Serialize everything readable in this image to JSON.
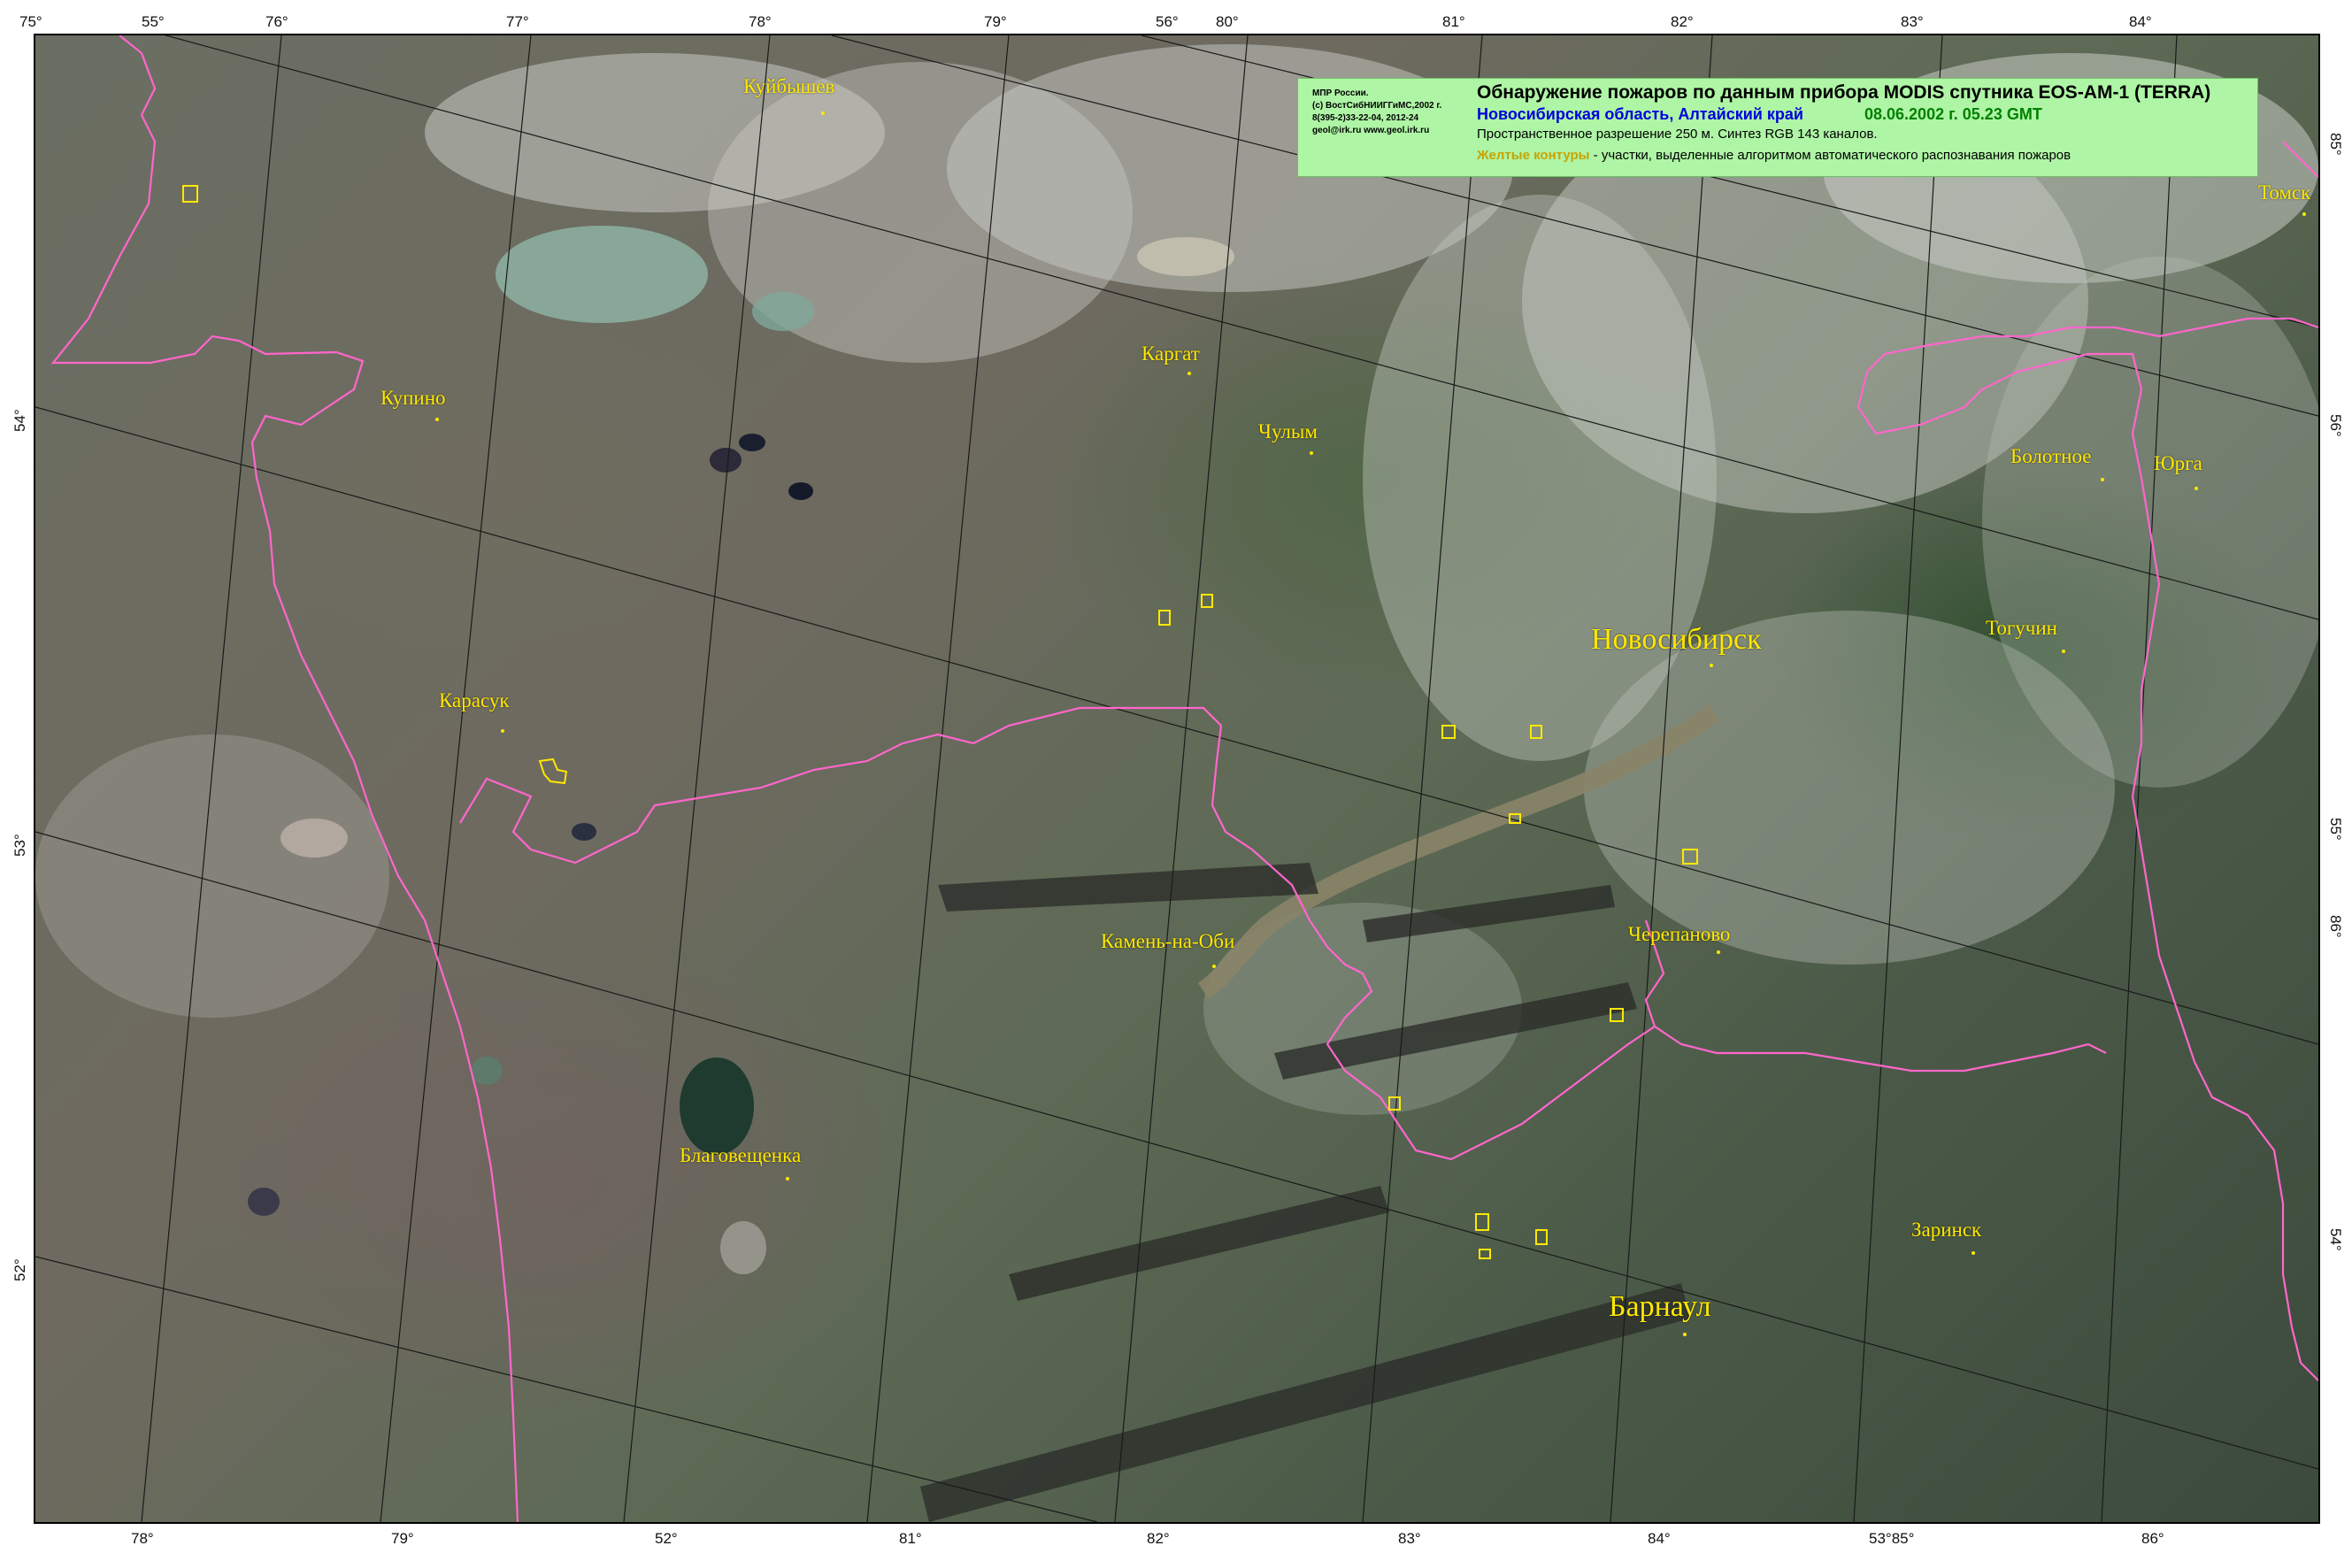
{
  "legend": {
    "org_line1": "МПР России.",
    "org_line2": "(с) ВостСибНИИГГиМС,2002 г.",
    "org_line3": "8(395-2)33-22-04, 2012-24",
    "org_line4": "geol@irk.ru  www.geol.irk.ru",
    "title": "Обнаружение пожаров по данным прибора MODIS спутника EOS-AM-1 (TERRA)",
    "region": "Новосибирская область, Алтайский край",
    "date": "08.06.2002 г. 05.23 GMT",
    "resolution": "Пространственное разрешение 250 м. Синтез RGB 143 каналов.",
    "note_colored": "Желтые контуры",
    "note_dash": " - ",
    "note_rest": "участки, выделенные алгоритмом автоматического распознавания пожаров"
  },
  "ticks_top": [
    "75°",
    "55°",
    "76°",
    "77°",
    "78°",
    "79°",
    "56°",
    "80°",
    "81°",
    "82°",
    "83°",
    "84°"
  ],
  "ticks_bottom": [
    "78°",
    "79°",
    "52°",
    "81°",
    "82°",
    "83°",
    "84°",
    "53°85°",
    "86°"
  ],
  "ticks_left": [
    "54°",
    "53°",
    "52°"
  ],
  "ticks_right": [
    "85°",
    "56°",
    "55°",
    "86°",
    "54°"
  ],
  "cities": {
    "kuybyshev": "Куйбышев",
    "kargat": "Каргат",
    "kupino": "Купино",
    "chulym": "Чулым",
    "tomsk": "Томск",
    "bolotnoe": "Болотное",
    "yurga": "Юрга",
    "novosibirsk": "Новосибирск",
    "toguchin": "Тогучин",
    "karasuk": "Карасук",
    "kamen": "Камень-на-Оби",
    "cherepanovo": "Черепаново",
    "blagoveshchenka": "Благовещенка",
    "zarinsk": "Заринск",
    "barnaul": "Барнаул"
  },
  "colors": {
    "border": "#ff66cc",
    "fire_contour": "#ffe800",
    "legend_bg": "#aef5a5"
  }
}
